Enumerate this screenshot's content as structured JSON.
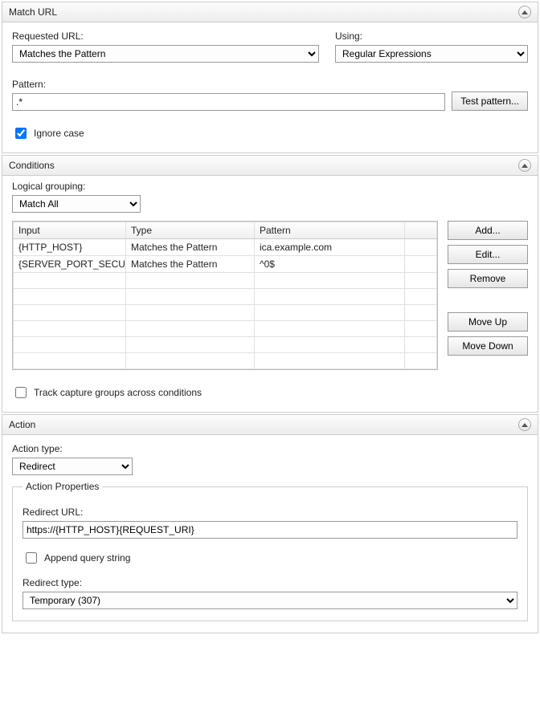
{
  "match_url": {
    "title": "Match URL",
    "requested_url_label": "Requested URL:",
    "requested_url_value": "Matches the Pattern",
    "using_label": "Using:",
    "using_value": "Regular Expressions",
    "pattern_label": "Pattern:",
    "pattern_value": ".*",
    "test_pattern_label": "Test pattern...",
    "ignore_case_label": "Ignore case",
    "ignore_case_checked": true
  },
  "conditions": {
    "title": "Conditions",
    "logical_grouping_label": "Logical grouping:",
    "logical_grouping_value": "Match All",
    "columns": {
      "input": "Input",
      "type": "Type",
      "pattern": "Pattern"
    },
    "rows": [
      {
        "input": "{HTTP_HOST}",
        "type": "Matches the Pattern",
        "pattern": "ica.example.com"
      },
      {
        "input": "{SERVER_PORT_SECURE}",
        "type": "Matches the Pattern",
        "pattern": "^0$"
      }
    ],
    "buttons": {
      "add": "Add...",
      "edit": "Edit...",
      "remove": "Remove",
      "move_up": "Move Up",
      "move_down": "Move Down"
    },
    "track_label": "Track capture groups across conditions",
    "track_checked": false
  },
  "action": {
    "title": "Action",
    "action_type_label": "Action type:",
    "action_type_value": "Redirect",
    "properties_title": "Action Properties",
    "redirect_url_label": "Redirect URL:",
    "redirect_url_value": "https://{HTTP_HOST}{REQUEST_URI}",
    "append_label": "Append query string",
    "append_checked": false,
    "redirect_type_label": "Redirect type:",
    "redirect_type_value": "Temporary (307)"
  }
}
